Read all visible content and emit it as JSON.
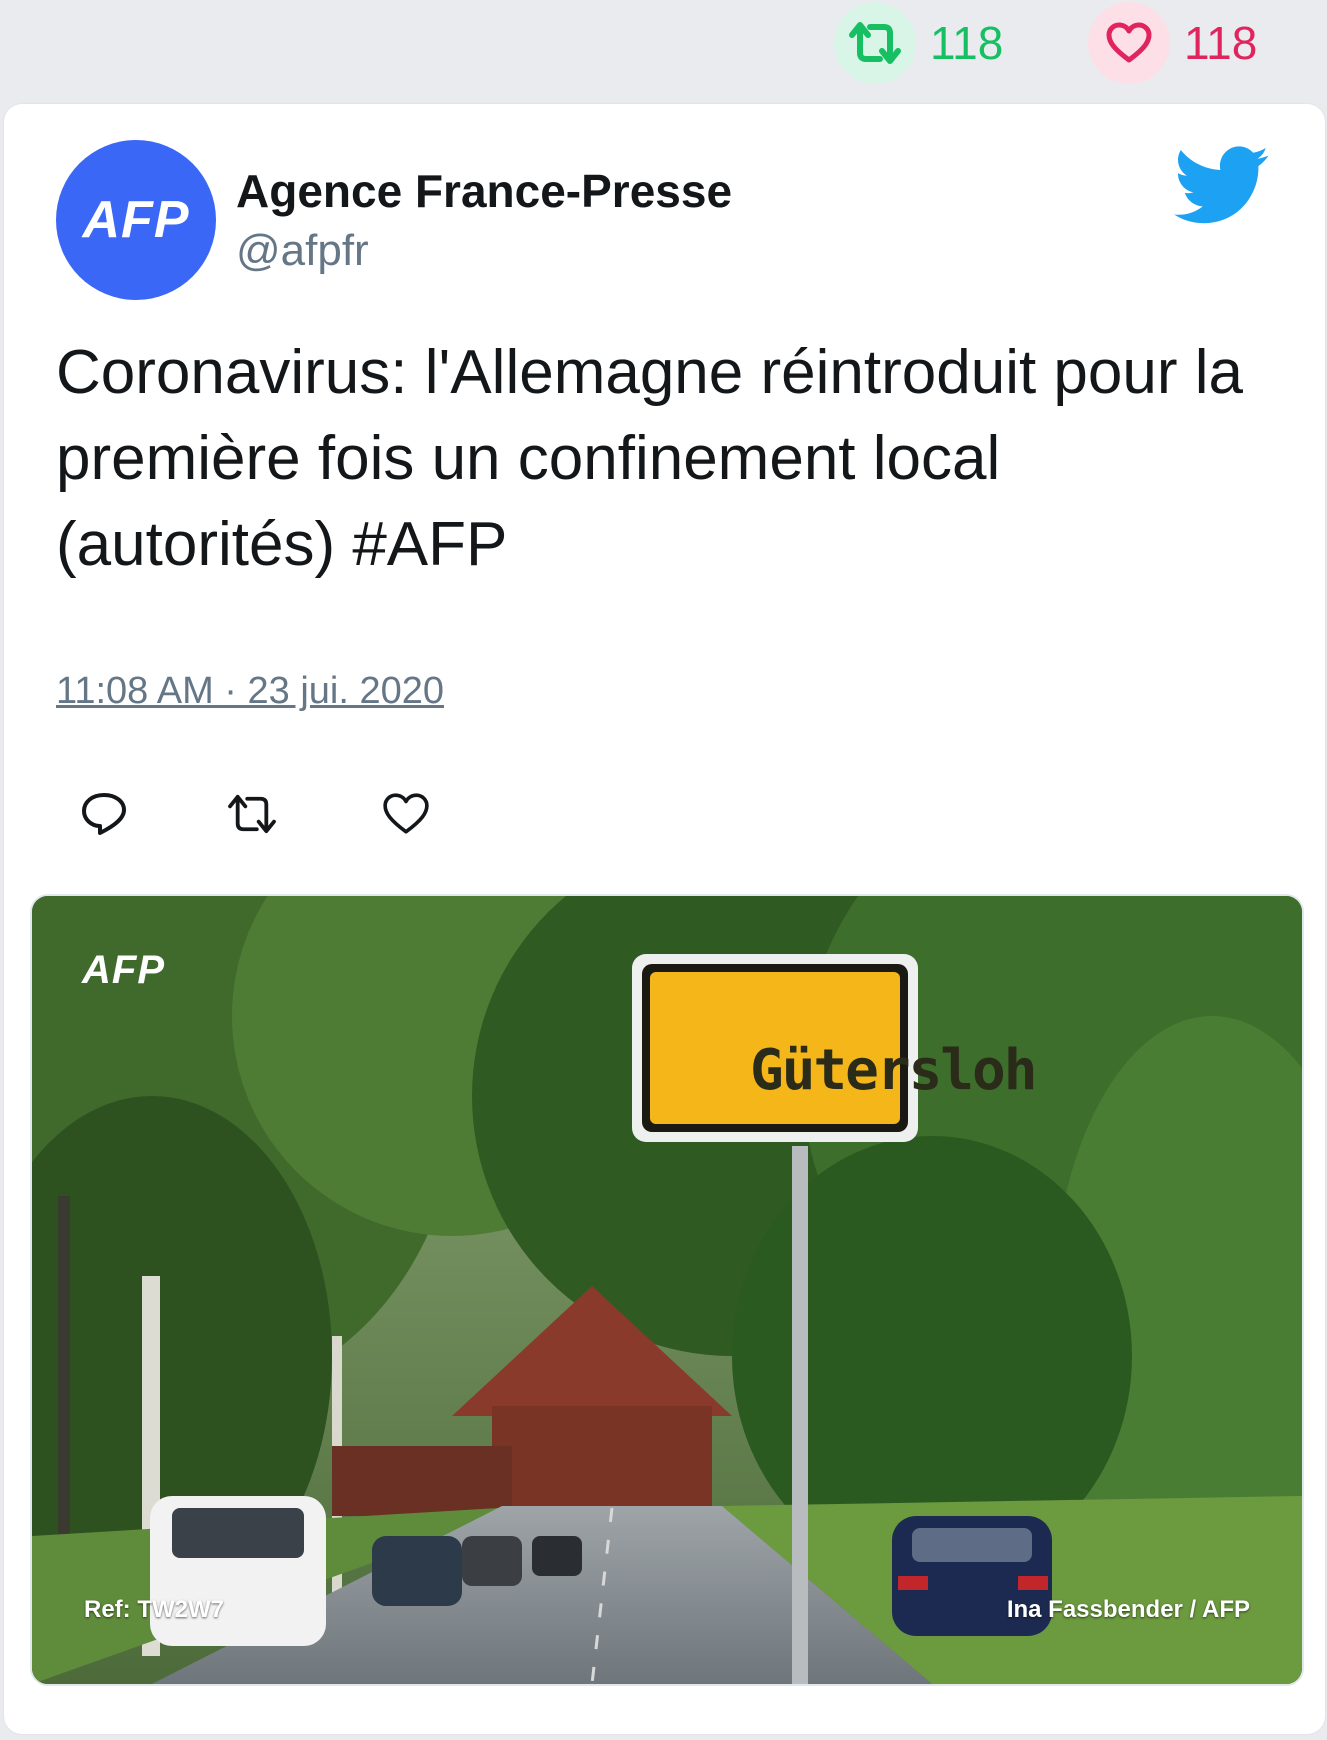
{
  "stats": {
    "retweets": "118",
    "likes": "118"
  },
  "colors": {
    "retweet": "#17bf63",
    "like": "#e0245e",
    "twitter_blue": "#1da1f2",
    "avatar_bg": "#3a67f6",
    "handle_gray": "#657786"
  },
  "tweet": {
    "author_name": "Agence France-Presse",
    "handle": "@afpfr",
    "avatar_text": "AFP",
    "text": "Coronavirus: l'Allemagne réintroduit pour la première fois un confinement local (autorités) #AFP",
    "timestamp": "11:08 AM · 23 jui. 2020"
  },
  "media": {
    "watermark": "AFP",
    "sign_text": "Gütersloh",
    "ref": "Ref: TW2W7",
    "credit": "Ina Fassbender / AFP"
  },
  "icons": {
    "stats_retweet": "retweet-icon",
    "stats_like": "heart-icon",
    "logo": "twitter-bird-icon",
    "reply": "reply-icon",
    "retweet": "retweet-icon",
    "like": "heart-icon"
  }
}
